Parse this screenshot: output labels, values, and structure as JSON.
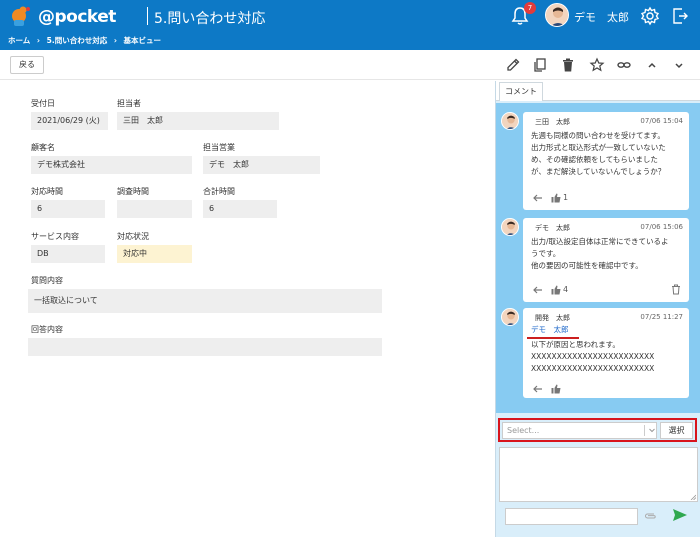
{
  "header": {
    "logo_text": "@pocket",
    "app_title": "5.問い合わせ対応",
    "notification_count": "7",
    "user_name": "デモ　太郎"
  },
  "breadcrumb": [
    "ホーム",
    "›",
    "5.問い合わせ対応",
    "›",
    "基本ビュー"
  ],
  "toolbar": {
    "back_label": "戻る",
    "icons": [
      "pencil-icon",
      "copy-icon",
      "trash-icon",
      "star-icon",
      "link-icon",
      "chevron-up-icon",
      "chevron-down-icon"
    ]
  },
  "form": {
    "received_date": {
      "label": "受付日",
      "value": "2021/06/29 (火)"
    },
    "assignee": {
      "label": "担当者",
      "value": "三田　太郎"
    },
    "customer": {
      "label": "顧客名",
      "value": "デモ株式会社"
    },
    "sales_rep": {
      "label": "担当営業",
      "value": "デモ　太郎"
    },
    "handling_time": {
      "label": "対応時間",
      "value": "6"
    },
    "research_time": {
      "label": "調査時間",
      "value": ""
    },
    "total_time": {
      "label": "合計時間",
      "value": "6"
    },
    "service": {
      "label": "サービス内容",
      "value": "DB"
    },
    "status": {
      "label": "対応状況",
      "value": "対応中"
    },
    "question": {
      "label": "質問内容",
      "value": "一括取込について"
    },
    "answer": {
      "label": "回答内容",
      "value": ""
    }
  },
  "side": {
    "tab_label": "コメント",
    "comments": [
      {
        "author": "三田　太郎",
        "time": "07/06 15:04",
        "lines": [
          "先週も同様の問い合わせを受けてます。",
          "出力形式と取込形式が一致していないた",
          "め、その確認依頼をしてもらいました",
          "が、まだ解決していないんでしょうか？"
        ],
        "likes": "1"
      },
      {
        "author": "デモ　太郎",
        "time": "07/06 15:06",
        "lines": [
          "出力/取込設定自体は正常にできているよ",
          "うです。",
          "他の要因の可能性を確認中です。"
        ],
        "likes": "4"
      },
      {
        "author": "開発　太郎",
        "time": "07/25 11:27",
        "mention": "デモ　太郎",
        "lines": [
          "以下が原因と思われます。",
          "XXXXXXXXXXXXXXXXXXXXXXXX",
          "XXXXXXXXXXXXXXXXXXXXXXXX"
        ],
        "likes": ""
      }
    ],
    "select_placeholder": "Select...",
    "select_button": "選択"
  },
  "colors": {
    "header_blue": "#0d79c6",
    "comment_bg": "#87cbf2",
    "highlight_red": "#d8141c",
    "send_green": "#2fa84f"
  }
}
